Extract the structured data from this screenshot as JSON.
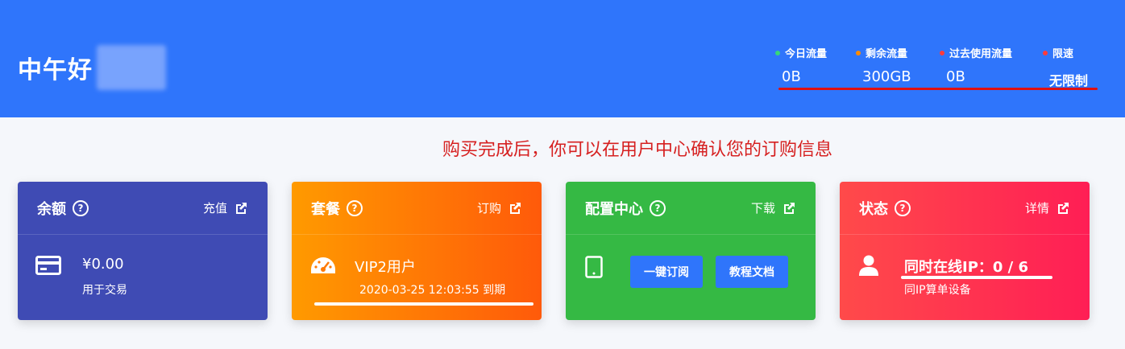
{
  "header": {
    "greeting": "中午好",
    "stats": [
      {
        "label": "今日流量",
        "value": "0B",
        "dot_color": "#37d67a"
      },
      {
        "label": "剩余流量",
        "value": "300GB",
        "dot_color": "#ff8a00"
      },
      {
        "label": "过去使用流量",
        "value": "0B",
        "dot_color": "#ff3b3b"
      },
      {
        "label": "限速",
        "value": "无限制",
        "dot_color": "#ff3b3b"
      }
    ]
  },
  "notice": "购买完成后，你可以在用户中心确认您的订购信息",
  "cards": {
    "balance": {
      "title": "余额",
      "action": "充值",
      "amount": "¥0.00",
      "subtitle": "用于交易",
      "icon": "credit-card-icon"
    },
    "plan": {
      "title": "套餐",
      "action": "订购",
      "name": "VIP2用户",
      "expiry": "2020-03-25 12:03:55 到期",
      "icon": "speedometer-icon"
    },
    "config": {
      "title": "配置中心",
      "action": "下载",
      "btn_subscribe": "一键订阅",
      "btn_docs": "教程文档",
      "icon": "tablet-icon"
    },
    "status": {
      "title": "状态",
      "action": "详情",
      "online": "同时在线IP：0 / 6",
      "subtitle": "同IP算单设备",
      "icon": "user-icon"
    }
  },
  "colors": {
    "header_bg": "#2f75fb",
    "balance_bg": "#3f4bb4",
    "plan_from": "#ff9a00",
    "plan_to": "#ff5a0a",
    "config_bg": "#35b944",
    "status_from": "#ff4a4a",
    "status_to": "#ff1e55",
    "notice": "#d62020"
  }
}
